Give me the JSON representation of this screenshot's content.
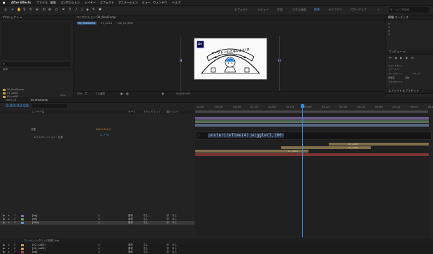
{
  "menu_bar": {
    "app_name": "After Effects",
    "items": [
      "ファイル",
      "編集",
      "コンポジション",
      "レイヤー",
      "エフェクト",
      "アニメーション",
      "ビュー",
      "ウィンドウ",
      "ヘルプ"
    ],
    "window_title": "Adobe After Effects 2023 - 名称未設定プロジェクト *"
  },
  "workspaces": [
    "デフォルト",
    "レビュー",
    "学習",
    "小さな画面",
    "標準",
    "ライブラリ",
    "パワーアップ"
  ],
  "workspace_active_index": 4,
  "search_help_placeholder": "ヘルプを検索",
  "project_panel": {
    "title": "プロジェクト",
    "search_icon": "search-icon",
    "col_name": "名前",
    "items": [
      {
        "name": "00_finalComp",
        "color": "#c8a24b"
      },
      {
        "name": "01_cut01",
        "color": "#c8a24b"
      },
      {
        "name": "02_cut02",
        "color": "#c8a24b"
      },
      {
        "name": "03_cut03",
        "color": "#c8a24b"
      },
      {
        "name": "ae素材",
        "color": "#6a8fbf"
      },
      {
        "name": "comp_01",
        "color": "#c8a24b"
      },
      {
        "name": "elements",
        "color": "#6a8fbf"
      },
      {
        "name": "平面",
        "color": "#6a8fbf"
      }
    ],
    "bpc": "8 bpc"
  },
  "comp_viewer": {
    "panel_title": "コンポジション 00_finalComp",
    "tabs": [
      "00_finalComp",
      "01_cut01",
      "sub_01_dare"
    ],
    "banner_text": "キーフレームとなかよく!!!",
    "ae_logo": "Ae",
    "zoom": "50%",
    "resolution": "フル画質",
    "timecode": "0;00;03;09"
  },
  "right_panel": {
    "info_title": "情報",
    "audio_title": "オーディオ",
    "preview_title": "プレビュー",
    "preview_rows": [
      "ショートカット",
      "スペースバー",
      "フレームレート",
      "スキップ",
      "解像度",
      "自動",
      "フルスクリーン"
    ],
    "effects_title": "エフェクト＆プリセット"
  },
  "timeline": {
    "tabs": [
      "comp_01",
      "00_finalComp"
    ],
    "current_time": "0:00:03:09",
    "columns": {
      "layer_name": "レイヤー名",
      "mode": "モード",
      "trkmat": "トラックマット",
      "parent": "親とリンク"
    },
    "layers": [
      {
        "num": "1",
        "name": "[bg]",
        "mode": "通常",
        "parent": "なし",
        "color": "#8a6aa6",
        "selected": false
      },
      {
        "num": "2",
        "name": "[ae]",
        "mode": "通常",
        "parent": "なし",
        "color": "#6f9f6f",
        "selected": false
      },
      {
        "num": "3",
        "name": "[title]",
        "mode": "通常",
        "parent": "なし",
        "color": "#6a8fbf",
        "selected": true
      },
      {
        "num": "4",
        "name": "[03_cut03]",
        "mode": "通常",
        "parent": "なし",
        "color": "#c8a24b",
        "selected": false
      },
      {
        "num": "5",
        "name": "[02_cut02]",
        "mode": "通常",
        "parent": "なし",
        "color": "#c8a24b",
        "selected": false
      },
      {
        "num": "6",
        "name": "[01_cut01]",
        "mode": "通常",
        "parent": "なし",
        "color": "#c8a24b",
        "selected": false
      },
      {
        "num": "7",
        "name": "[bg]",
        "mode": "通常",
        "parent": "なし",
        "color": "#b84a4a",
        "selected": false
      }
    ],
    "sub_property": "位置",
    "sub_value": "960.0,540.0",
    "expression_label": "エクスプレッション：位置",
    "expression_code": "posterizeTime(4);wiggle(1,100)",
    "ruler_ticks": [
      "0:00f",
      "00:12f",
      "01:00f",
      "01:12f",
      "02:00f",
      "02:12f",
      "03:00f",
      "03:12f",
      "04:00f",
      "04:12f",
      "05:00f",
      "05:12f",
      "06:00f",
      "06:12f"
    ],
    "playhead_fraction": 0.46,
    "bar_labels": [
      "01_cut01",
      "02_cut02",
      "03_cut03"
    ],
    "status": "フレームレンダリング時間 1ms"
  },
  "colors": {
    "accent": "#2d8ceb",
    "bg": "#1b1b1b",
    "panel": "#232323"
  }
}
